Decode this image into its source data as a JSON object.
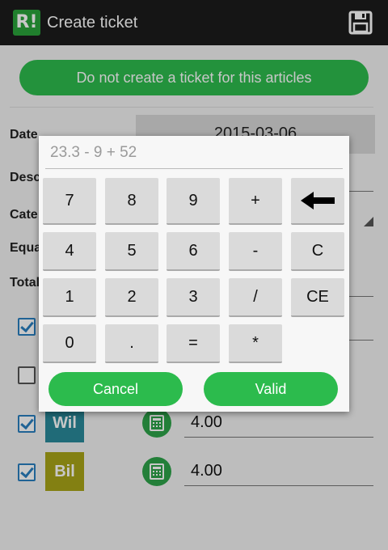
{
  "app": {
    "logo_text": "R!",
    "title": "Create ticket"
  },
  "header": {
    "save_icon": "save-icon"
  },
  "form": {
    "no_create_label": "Do not create a ticket for this articles",
    "date_label": "Date",
    "date_value": "2015-03-06",
    "description_label": "Desc",
    "category_label": "Cate",
    "equal_label": "Equa",
    "total_label": "Total"
  },
  "rows": [
    {
      "checked": true,
      "badge": "",
      "value": ""
    },
    {
      "checked": false,
      "badge": "",
      "value": ""
    },
    {
      "checked": true,
      "badge": "Wil",
      "badge_color": "#2a8a9a",
      "value": "4.00"
    },
    {
      "checked": true,
      "badge": "Bil",
      "badge_color": "#a8a418",
      "value": "4.00"
    }
  ],
  "calculator": {
    "expression": "23.3 - 9 + 52",
    "keys": {
      "k7": "7",
      "k8": "8",
      "k9": "9",
      "plus": "+",
      "backspace_icon": "backspace-arrow-icon",
      "k4": "4",
      "k5": "5",
      "k6": "6",
      "minus": "-",
      "clear": "C",
      "k1": "1",
      "k2": "2",
      "k3": "3",
      "divide": "/",
      "clear_entry": "CE",
      "k0": "0",
      "dot": ".",
      "equals": "=",
      "multiply": "*"
    },
    "cancel_label": "Cancel",
    "valid_label": "Valid"
  },
  "colors": {
    "accent_green": "#2dbb4e",
    "topbar": "#1c1c1c"
  }
}
